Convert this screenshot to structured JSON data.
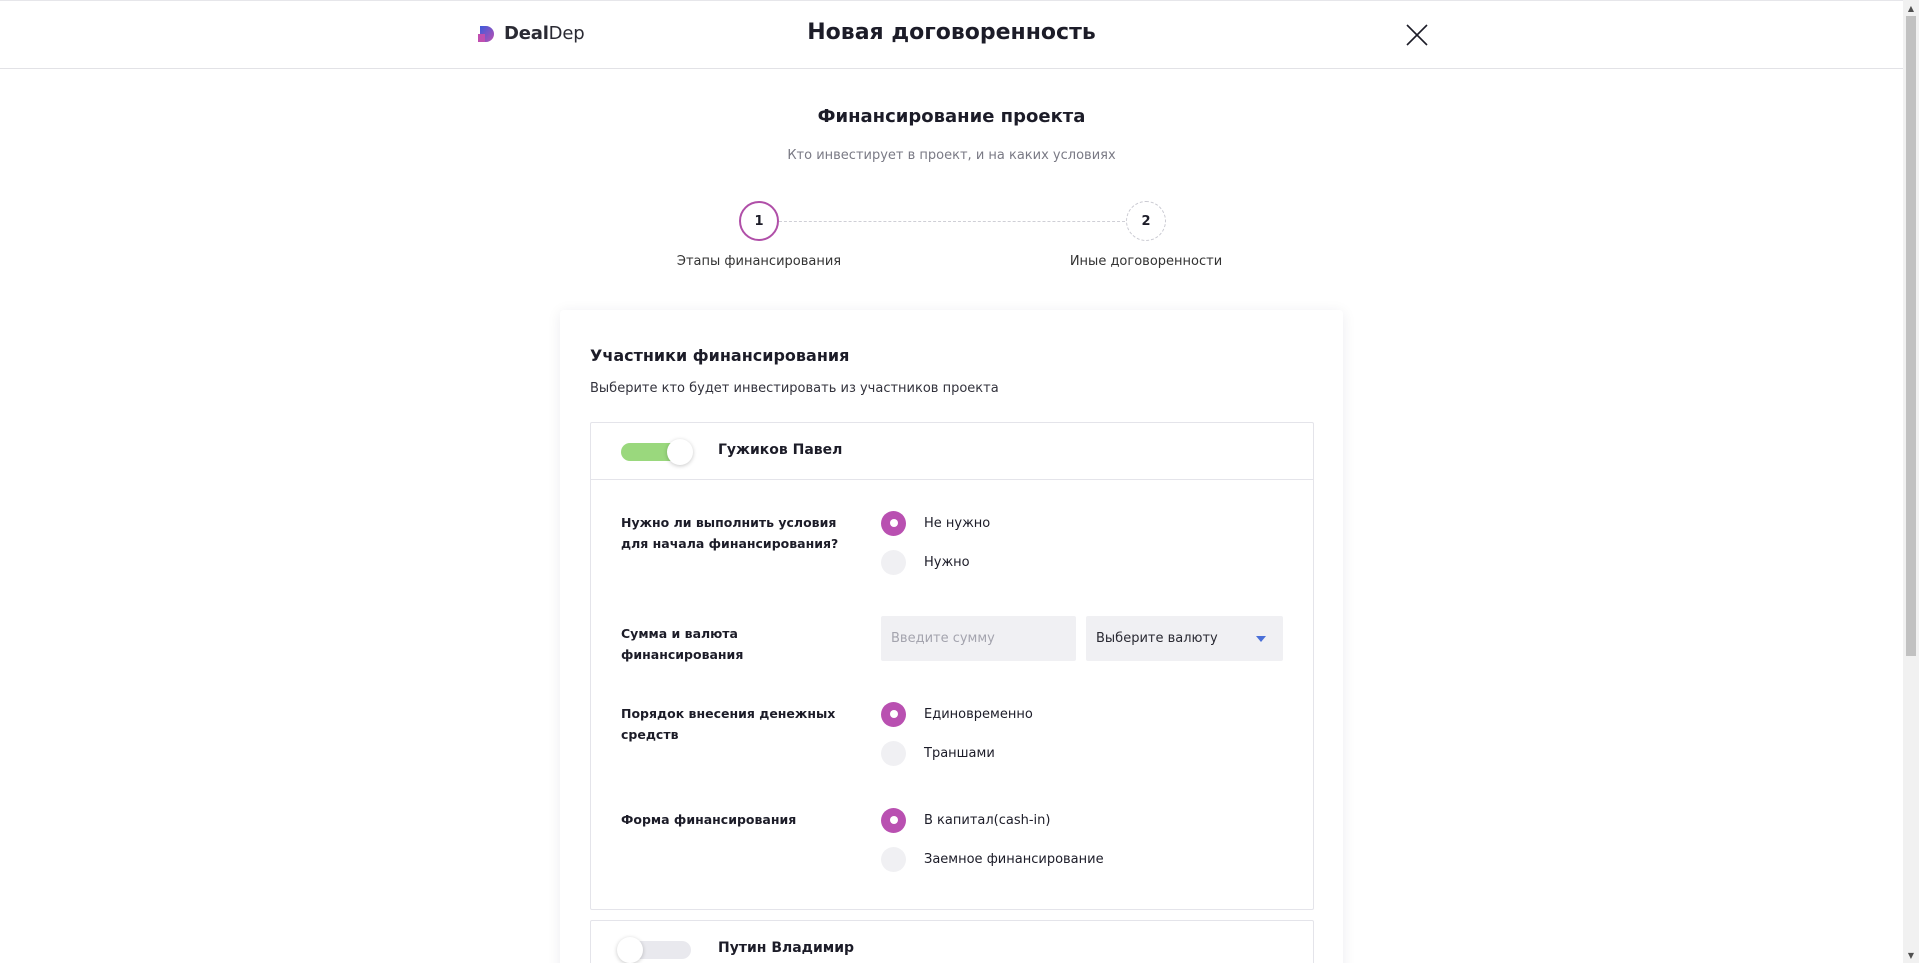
{
  "header": {
    "logo_bold": "Deal",
    "logo_light": "Dep",
    "title": "Новая договоренность",
    "close_icon": "close-icon"
  },
  "page": {
    "title": "Финансирование проекта",
    "subtitle": "Кто инвестирует в проект, и на каких условиях"
  },
  "stepper": {
    "steps": [
      {
        "number": "1",
        "label": "Этапы финансирования",
        "state": "active"
      },
      {
        "number": "2",
        "label": "Иные договоренности",
        "state": "inactive"
      }
    ]
  },
  "card": {
    "title": "Участники финансирования",
    "subtitle": "Выберите кто будет инвестировать из участников проекта"
  },
  "participants": [
    {
      "name": "Гужиков Павел",
      "enabled": true,
      "conditions": {
        "label": "Нужно ли выполнить условия для начала финансирования?",
        "options": [
          "Не нужно",
          "Нужно"
        ],
        "selected": "Не нужно"
      },
      "amount": {
        "label": "Сумма и валюта финансирования",
        "amount_placeholder": "Введите сумму",
        "amount_value": "",
        "currency_value": "Выберите валюту"
      },
      "payment_order": {
        "label": "Порядок внесения денежных средств",
        "options": [
          "Единовременно",
          "Траншами"
        ],
        "selected": "Единовременно"
      },
      "form": {
        "label": "Форма финансирования",
        "options": [
          "В капитал(cash-in)",
          "Заемное финансирование"
        ],
        "selected": "В капитал(cash-in)"
      }
    },
    {
      "name": "Путин Владимир",
      "enabled": false
    }
  ],
  "colors": {
    "accent": "#b950b1",
    "toggle_on": "#9ad87d",
    "field_bg": "#f0f0f3",
    "caret": "#4a6fd8"
  }
}
